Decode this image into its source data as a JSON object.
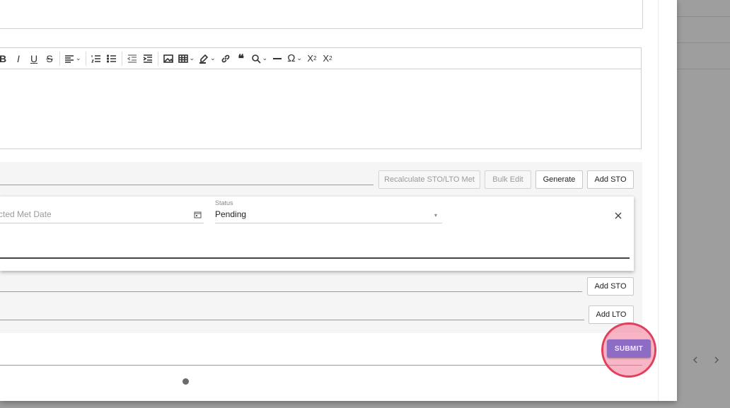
{
  "editor": {
    "toolbar": [
      {
        "name": "bold-icon",
        "glyph": "B"
      },
      {
        "name": "italic-icon",
        "glyph": "I"
      },
      {
        "name": "underline-icon",
        "glyph": "U"
      },
      {
        "name": "strikethrough-icon",
        "glyph": "S"
      },
      {
        "name": "align-icon",
        "glyph": "≡"
      },
      {
        "name": "numbered-list-icon",
        "glyph": "⋮≡"
      },
      {
        "name": "bulleted-list-icon",
        "glyph": "•≡"
      },
      {
        "name": "outdent-icon",
        "glyph": "⇤"
      },
      {
        "name": "indent-icon",
        "glyph": "⇥"
      },
      {
        "name": "image-icon",
        "glyph": "▣"
      },
      {
        "name": "table-icon",
        "glyph": "⊞"
      },
      {
        "name": "highlight-icon",
        "glyph": "✎"
      },
      {
        "name": "link-icon",
        "glyph": "⛓"
      },
      {
        "name": "quote-icon",
        "glyph": "❝"
      },
      {
        "name": "find-replace-icon",
        "glyph": "⌕"
      },
      {
        "name": "horizontal-line-icon",
        "glyph": "—"
      },
      {
        "name": "special-characters-icon",
        "glyph": "Ω"
      },
      {
        "name": "subscript-icon",
        "glyph": "X₂"
      },
      {
        "name": "superscript-icon",
        "glyph": "X²"
      }
    ]
  },
  "goals": {
    "recalculate_label": "Recalculate STO/LTO Met",
    "bulk_edit_label": "Bulk Edit",
    "generate_label": "Generate",
    "add_sto_label": "Add STO",
    "card": {
      "met_date_placeholder": "cted Met Date",
      "status_label": "Status",
      "status_value": "Pending"
    },
    "add_sto_label_2": "Add STO",
    "add_lto_label": "Add LTO"
  },
  "submit_label": "SUBMIT"
}
